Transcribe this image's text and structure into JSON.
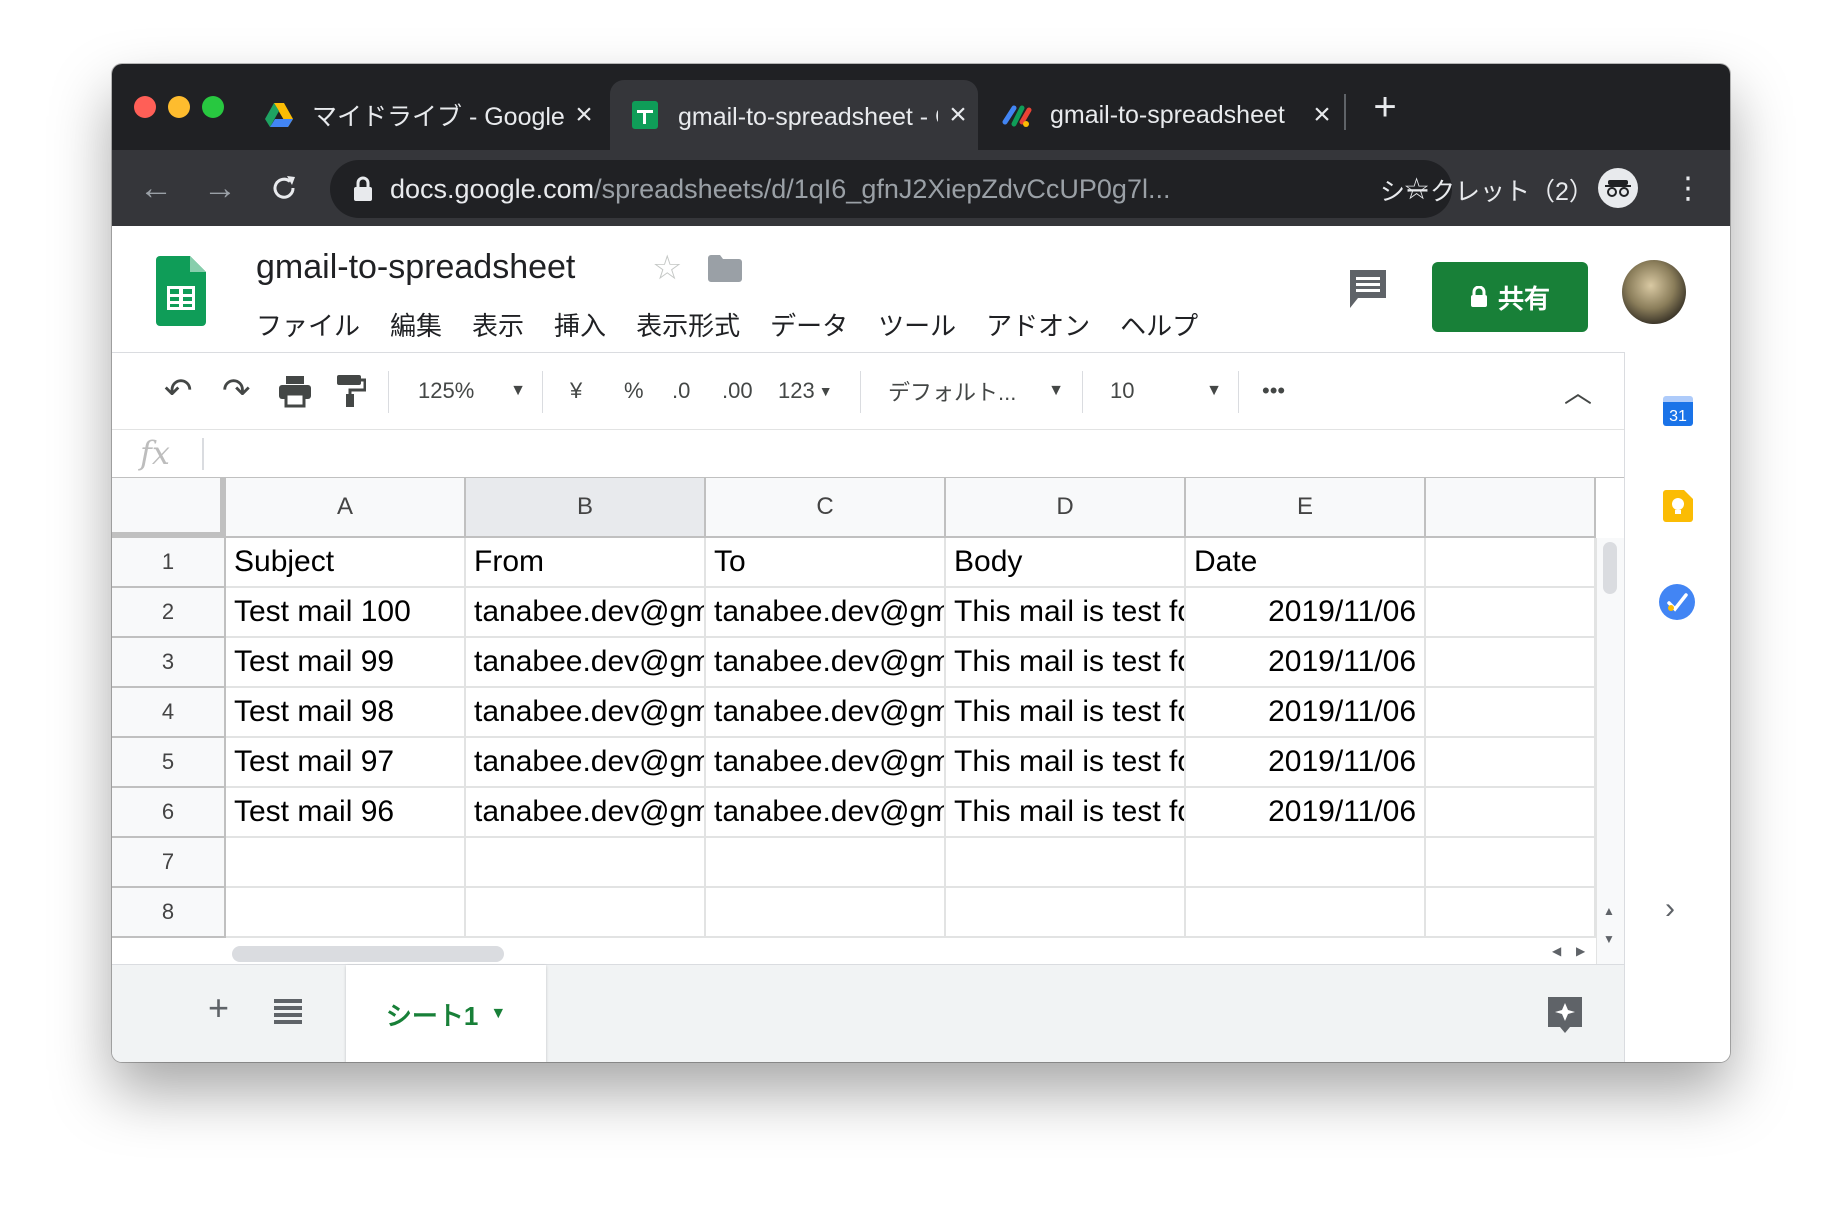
{
  "browser": {
    "tabs": [
      {
        "title": "マイドライブ - Google ドライブ",
        "icon": "google-drive-icon",
        "active": false
      },
      {
        "title": "gmail-to-spreadsheet - Google スプレッドシート",
        "icon": "sheets-icon",
        "active": true
      },
      {
        "title": "gmail-to-spreadsheet",
        "icon": "apps-script-icon",
        "active": false
      }
    ],
    "new_tab_label": "+",
    "url_domain": "docs.google.com",
    "url_path": "/spreadsheets/d/1qI6_gfnJ2XiepZdvCcUP0g7l...",
    "incognito_label": "シークレット（2）"
  },
  "sheet": {
    "title": "gmail-to-spreadsheet",
    "menu": [
      "ファイル",
      "編集",
      "表示",
      "挿入",
      "表示形式",
      "データ",
      "ツール",
      "アドオン",
      "ヘルプ"
    ],
    "share_label": "共有",
    "toolbar": {
      "zoom": "125%",
      "currency": "¥",
      "percent": "%",
      "dec_decrease": ".0",
      "dec_increase": ".00",
      "more_formats": "123",
      "font": "デフォルト...",
      "font_size": "10",
      "more": "•••"
    },
    "formula_label": "fx",
    "columns": [
      "A",
      "B",
      "C",
      "D",
      "E"
    ],
    "rows": [
      {
        "n": "1",
        "cells": [
          "Subject",
          "From",
          "To",
          "Body",
          "Date"
        ]
      },
      {
        "n": "2",
        "cells": [
          "Test mail 100",
          "tanabee.dev@gmail.com",
          "tanabee.dev@gmail.com",
          "This mail is test for",
          "2019/11/06"
        ]
      },
      {
        "n": "3",
        "cells": [
          "Test mail 99",
          "tanabee.dev@gmail.com",
          "tanabee.dev@gmail.com",
          "This mail is test for",
          "2019/11/06"
        ]
      },
      {
        "n": "4",
        "cells": [
          "Test mail 98",
          "tanabee.dev@gmail.com",
          "tanabee.dev@gmail.com",
          "This mail is test for",
          "2019/11/06"
        ]
      },
      {
        "n": "5",
        "cells": [
          "Test mail 97",
          "tanabee.dev@gmail.com",
          "tanabee.dev@gmail.com",
          "This mail is test for",
          "2019/11/06"
        ]
      },
      {
        "n": "6",
        "cells": [
          "Test mail 96",
          "tanabee.dev@gmail.com",
          "tanabee.dev@gmail.com",
          "This mail is test for",
          "2019/11/06"
        ]
      },
      {
        "n": "7",
        "cells": [
          "",
          "",
          "",
          "",
          ""
        ]
      },
      {
        "n": "8",
        "cells": [
          "",
          "",
          "",
          "",
          ""
        ]
      }
    ],
    "sheet_tab": "シート1",
    "calendar_day": "31"
  },
  "colors": {
    "green": "#188038",
    "calendar_blue": "#1a73e8",
    "keep_yellow": "#fbbc04",
    "tasks_blue": "#4285f4"
  }
}
